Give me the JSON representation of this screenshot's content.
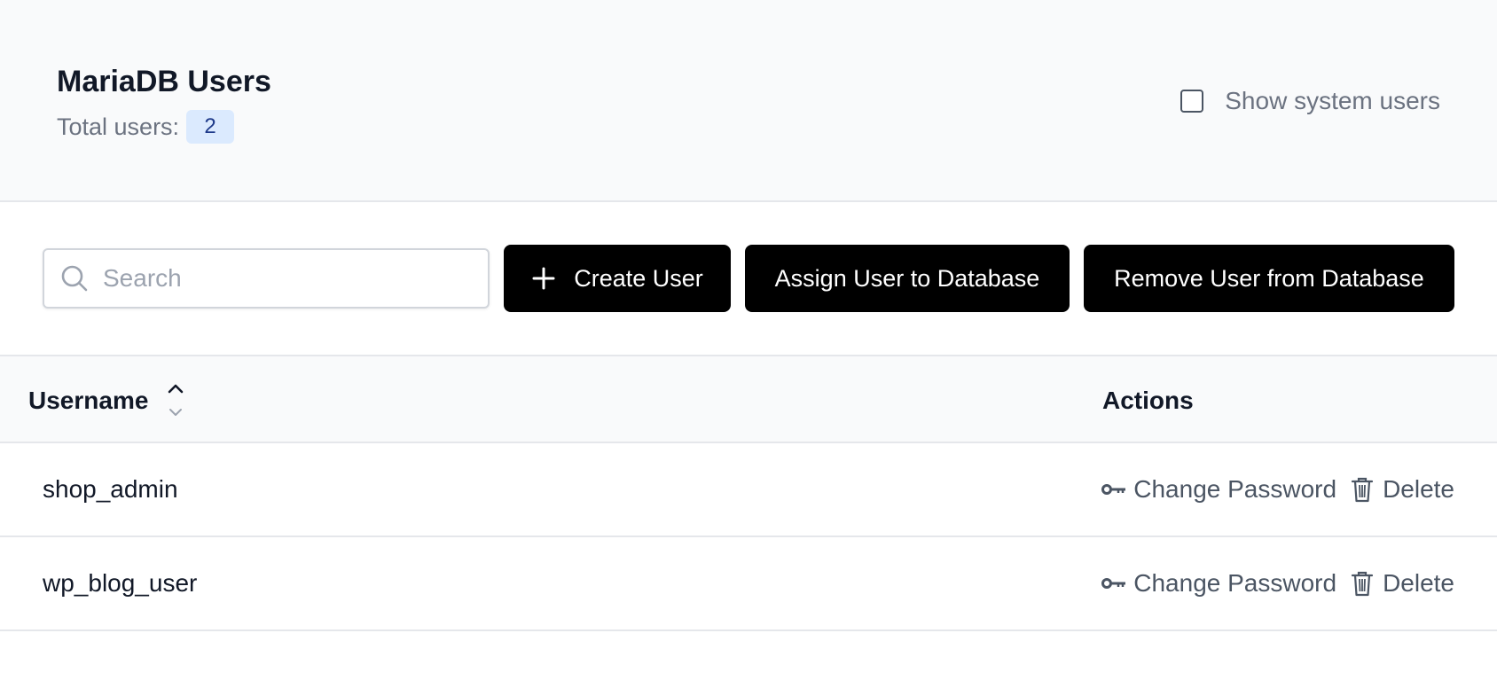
{
  "header": {
    "title": "MariaDB Users",
    "total_label": "Total users:",
    "total_count": "2",
    "show_system_users": {
      "label": "Show system users",
      "checked": false
    }
  },
  "toolbar": {
    "search_placeholder": "Search",
    "search_value": "",
    "create_label": "Create User",
    "assign_label": "Assign User to Database",
    "remove_label": "Remove User from Database"
  },
  "table": {
    "columns": {
      "username": "Username",
      "actions": "Actions"
    },
    "sort": "ascending",
    "rows": [
      {
        "username": "shop_admin",
        "change_password": "Change Password",
        "delete": "Delete"
      },
      {
        "username": "wp_blog_user",
        "change_password": "Change Password",
        "delete": "Delete"
      }
    ]
  },
  "icons": [
    "search-icon",
    "plus-icon",
    "sort-icon",
    "key-icon",
    "trash-icon"
  ],
  "colors": {
    "primary_button": "#000000",
    "badge_bg": "#dbeafe",
    "badge_text": "#1e3a8a",
    "muted_text": "#6b7280",
    "header_bg": "#f9fafb"
  }
}
